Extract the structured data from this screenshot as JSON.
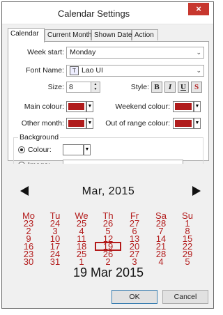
{
  "window": {
    "title": "Calendar Settings",
    "close_glyph": "×"
  },
  "tabs": [
    "Calendar",
    "Current Month",
    "Shown Date",
    "Action"
  ],
  "form": {
    "week_start_label": "Week start:",
    "week_start_value": "Monday",
    "font_name_label": "Font Name:",
    "font_name_value": "Lao UI",
    "font_icon": "truetype-font-icon",
    "size_label": "Size:",
    "size_value": "8",
    "style_label": "Style:",
    "style_buttons": [
      "B",
      "I",
      "U",
      "S"
    ],
    "main_colour_label": "Main colour:",
    "weekend_colour_label": "Weekend colour:",
    "other_month_label": "Other month:",
    "out_of_range_label": "Out of range colour:",
    "swatch_colour": "#b01c1c",
    "background_group": "Background",
    "colour_radio_label": "Colour:",
    "image_radio_label": "Image:",
    "background_colour": "#ffffff",
    "browse_label": "..."
  },
  "calendar": {
    "month_title": "Mar, 2015",
    "day_headers": [
      "Mo",
      "Tu",
      "We",
      "Th",
      "Fr",
      "Sa",
      "Su"
    ],
    "weeks": [
      [
        "23",
        "24",
        "25",
        "26",
        "27",
        "28",
        "1"
      ],
      [
        "2",
        "3",
        "4",
        "5",
        "6",
        "7",
        "8"
      ],
      [
        "9",
        "10",
        "11",
        "12",
        "13",
        "14",
        "15"
      ],
      [
        "16",
        "17",
        "18",
        "19",
        "20",
        "21",
        "22"
      ],
      [
        "23",
        "24",
        "25",
        "26",
        "27",
        "28",
        "29"
      ],
      [
        "30",
        "31",
        "1",
        "2",
        "3",
        "4",
        "5"
      ]
    ],
    "today": "19",
    "today_label": "19 Mar 2015",
    "accent_color": "#b31b1b"
  },
  "buttons": {
    "ok": "OK",
    "cancel": "Cancel"
  }
}
